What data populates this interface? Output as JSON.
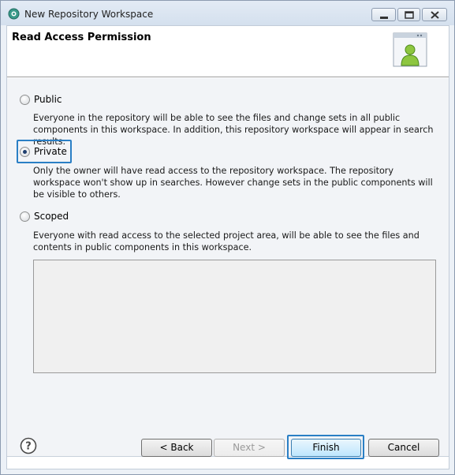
{
  "window": {
    "title": "New Repository Workspace",
    "controls": [
      "minimize-icon",
      "maximize-icon",
      "close-icon"
    ]
  },
  "header": {
    "title": "Read Access Permission",
    "banner_icon": "user-window-icon"
  },
  "options": [
    {
      "label": "Public",
      "checked": false,
      "description": "Everyone in the repository will be able to see the files and change sets in all public components in this workspace. In addition, this repository workspace will appear in search results."
    },
    {
      "label": "Private",
      "checked": true,
      "description": "Only the owner will have read access to the repository workspace. The repository workspace won't show up in searches. However change sets in the public components will be visible to others."
    },
    {
      "label": "Scoped",
      "checked": false,
      "description": "Everyone with read access to the selected project area, will be able to see the files and contents in public components in this workspace."
    }
  ],
  "footer": {
    "help_icon": "help-icon",
    "back_label": "< Back",
    "next_label": "Next >",
    "finish_label": "Finish",
    "cancel_label": "Cancel"
  },
  "colors": {
    "focus": "#2a7fc5",
    "titlebar": "#d4e0ee"
  }
}
